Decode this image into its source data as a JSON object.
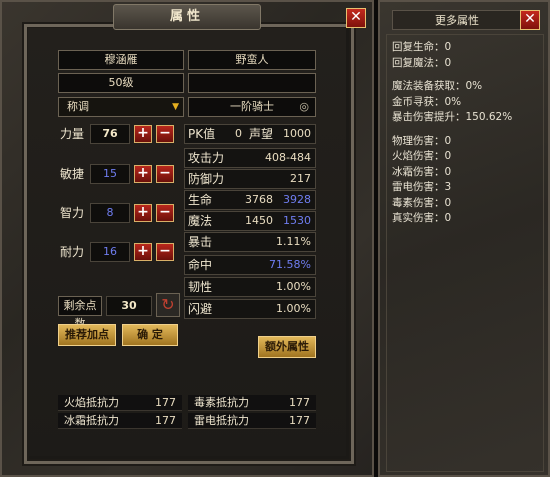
{
  "main_panel": {
    "title": "属性",
    "name": "穆涵雁",
    "level": "50级",
    "faction": "野蛮人",
    "rank": "一阶骑士",
    "title_label": "称调",
    "title_value": ""
  },
  "base_stats": [
    {
      "label": "力量",
      "value": "76"
    },
    {
      "label": "敏捷",
      "value": "15"
    },
    {
      "label": "智力",
      "value": "8"
    },
    {
      "label": "耐力",
      "value": "16"
    }
  ],
  "points": {
    "label": "剩余点数",
    "value": "30"
  },
  "buttons": {
    "recommend": "推荐加点",
    "confirm": "确 定",
    "extra": "额外属性"
  },
  "pk": {
    "label": "PK值",
    "value": "0",
    "fame_label": "声望",
    "fame_value": "1000"
  },
  "stats": {
    "attack": {
      "label": "攻击力",
      "value": "408-484"
    },
    "defense": {
      "label": "防御力",
      "value": "217"
    },
    "life": {
      "label": "生命",
      "value": "3768",
      "max": "3928"
    },
    "mana": {
      "label": "魔法",
      "value": "1450",
      "max": "1530"
    },
    "crit": {
      "label": "暴击",
      "value": "1.11%"
    },
    "hit": {
      "label": "命中",
      "value": "71.58%"
    },
    "tough": {
      "label": "韧性",
      "value": "1.00%"
    },
    "dodge": {
      "label": "闪避",
      "value": "1.00%"
    }
  },
  "resists": {
    "fire": {
      "label": "火焰抵抗力",
      "value": "177"
    },
    "poison": {
      "label": "毒素抵抗力",
      "value": "177"
    },
    "ice": {
      "label": "冰霜抵抗力",
      "value": "177"
    },
    "thunder": {
      "label": "雷电抵抗力",
      "value": "177"
    }
  },
  "side_panel": {
    "title": "更多属性",
    "group1": [
      "回复生命：0",
      "回复魔法：0"
    ],
    "group2": [
      "魔法装备获取：0%",
      "金币寻获：0%",
      "暴击伤害提升：150.62%"
    ],
    "group3": [
      "物理伤害：0",
      "火焰伤害：0",
      "冰霜伤害：0",
      "雷电伤害：3",
      "毒素伤害：0",
      "真实伤害：0"
    ]
  },
  "icons": {
    "close": "close-icon",
    "dropdown": "dropdown-arrow-icon",
    "eye": "eye-icon",
    "reset": "reset-swirl-icon",
    "plus": "plus-icon",
    "minus": "minus-icon"
  },
  "colors": {
    "accent_gold": "#e2b85a",
    "close_red": "#c42a1e",
    "blue_value": "#6f7df0"
  }
}
